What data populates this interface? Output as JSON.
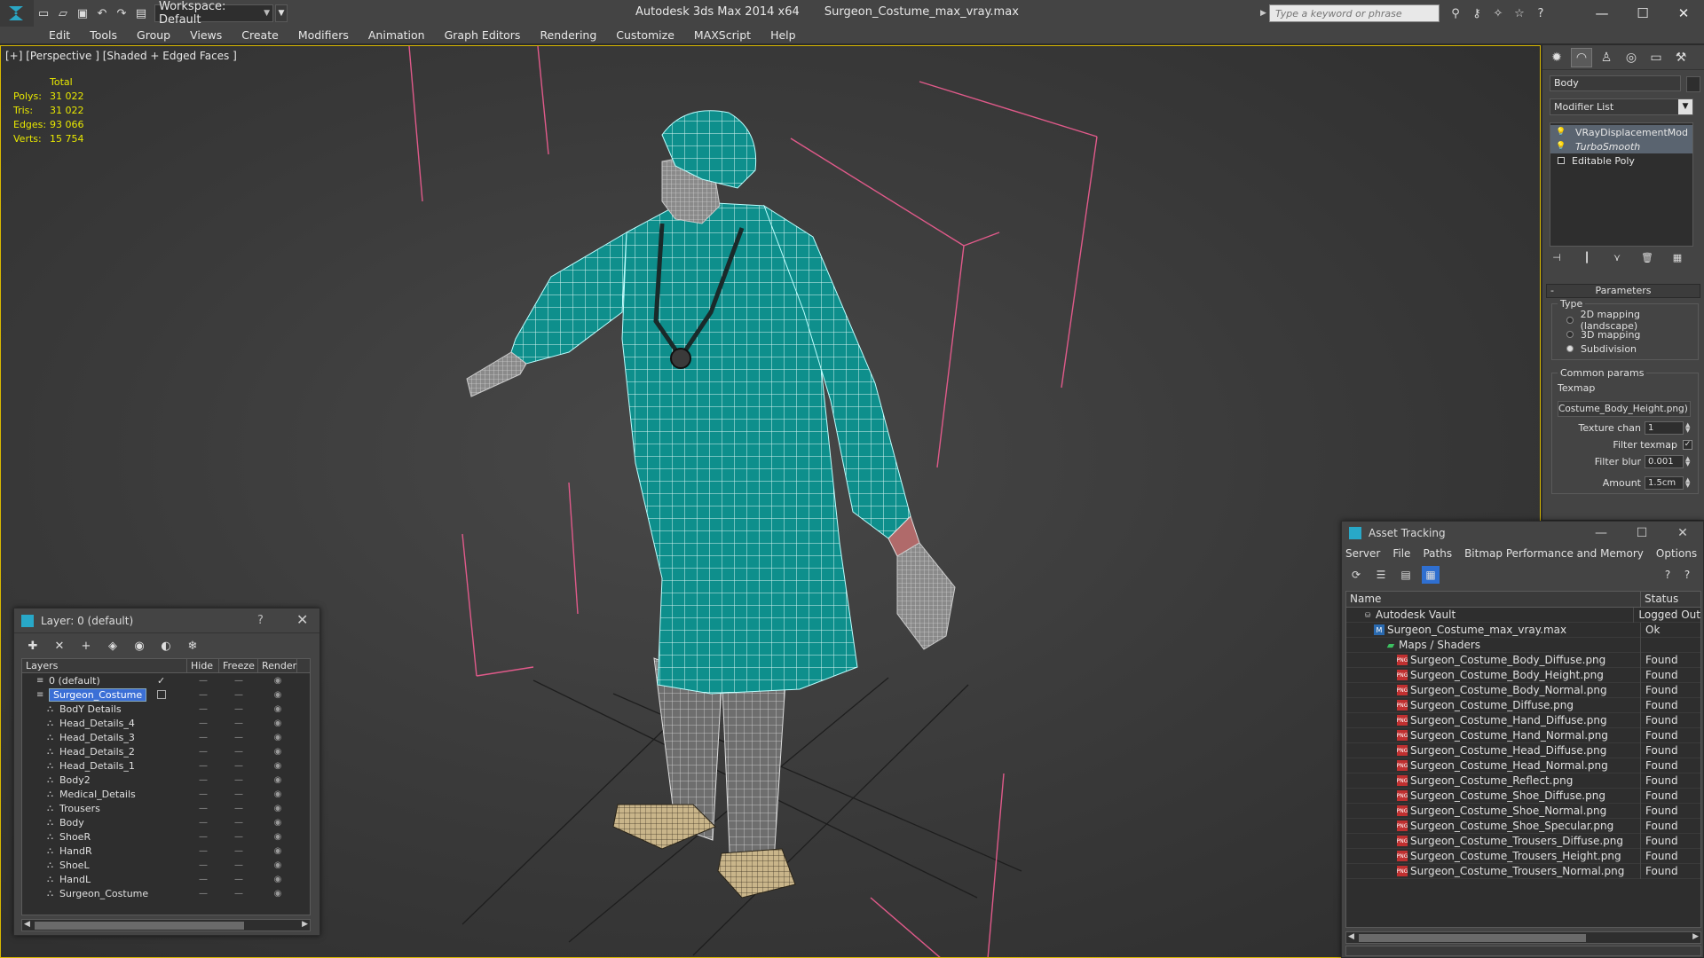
{
  "titlebar": {
    "workspace": "Workspace: Default",
    "app_name": "Autodesk 3ds Max  2014 x64",
    "file_name": "Surgeon_Costume_max_vray.max",
    "search_placeholder": "Type a keyword or phrase"
  },
  "menu": [
    "Edit",
    "Tools",
    "Group",
    "Views",
    "Create",
    "Modifiers",
    "Animation",
    "Graph Editors",
    "Rendering",
    "Customize",
    "MAXScript",
    "Help"
  ],
  "viewport": {
    "label": "[+] [Perspective ] [Shaded + Edged Faces ]",
    "stats": {
      "total_label": "Total",
      "rows": [
        {
          "label": "Polys:",
          "value": "31 022"
        },
        {
          "label": "Tris:",
          "value": "31 022"
        },
        {
          "label": "Edges:",
          "value": "93 066"
        },
        {
          "label": "Verts:",
          "value": "15 754"
        }
      ]
    }
  },
  "command_panel": {
    "object_name": "Body",
    "modifier_list": "Modifier List",
    "stack": [
      {
        "name": "VRayDisplacementMod",
        "italic": false,
        "selected": true
      },
      {
        "name": "TurboSmooth",
        "italic": true,
        "selected": true
      },
      {
        "name": "Editable Poly",
        "italic": false,
        "selected": false
      }
    ],
    "parameters_title": "Parameters",
    "type_group": "Type",
    "type_options": [
      "2D mapping (landscape)",
      "3D mapping",
      "Subdivision"
    ],
    "type_selected": 2,
    "common_group": "Common params",
    "texmap_label": "Texmap",
    "texmap_value": "Costume_Body_Height.png)",
    "texture_chan_label": "Texture chan",
    "texture_chan_value": "1",
    "filter_texmap_label": "Filter texmap",
    "filter_blur_label": "Filter blur",
    "filter_blur_value": "0.001",
    "amount_label": "Amount",
    "amount_value": "1.5cm"
  },
  "layer_window": {
    "title": "Layer: 0 (default)",
    "help": "?",
    "columns": [
      "Layers",
      "Hide",
      "Freeze",
      "Render"
    ],
    "rows": [
      {
        "name": "0 (default)",
        "level": 0,
        "type": "layer",
        "active": true,
        "selected": false
      },
      {
        "name": "Surgeon_Costume",
        "level": 0,
        "type": "layer",
        "active": false,
        "selected": true
      },
      {
        "name": "BodY Details",
        "level": 1,
        "type": "object"
      },
      {
        "name": "Head_Details_4",
        "level": 1,
        "type": "object"
      },
      {
        "name": "Head_Details_3",
        "level": 1,
        "type": "object"
      },
      {
        "name": "Head_Details_2",
        "level": 1,
        "type": "object"
      },
      {
        "name": "Head_Details_1",
        "level": 1,
        "type": "object"
      },
      {
        "name": "Body2",
        "level": 1,
        "type": "object"
      },
      {
        "name": "Medical_Details",
        "level": 1,
        "type": "object"
      },
      {
        "name": "Trousers",
        "level": 1,
        "type": "object"
      },
      {
        "name": "Body",
        "level": 1,
        "type": "object"
      },
      {
        "name": "ShoeR",
        "level": 1,
        "type": "object"
      },
      {
        "name": "HandR",
        "level": 1,
        "type": "object"
      },
      {
        "name": "ShoeL",
        "level": 1,
        "type": "object"
      },
      {
        "name": "HandL",
        "level": 1,
        "type": "object"
      },
      {
        "name": "Surgeon_Costume",
        "level": 1,
        "type": "object"
      }
    ]
  },
  "asset_window": {
    "title": "Asset Tracking",
    "menu": [
      "Server",
      "File",
      "Paths",
      "Bitmap Performance and Memory",
      "Options"
    ],
    "columns": [
      "Name",
      "Status"
    ],
    "rows": [
      {
        "name": "Autodesk Vault",
        "status": "Logged Out",
        "level": 0,
        "icon": "vault"
      },
      {
        "name": "Surgeon_Costume_max_vray.max",
        "status": "Ok",
        "level": 1,
        "icon": "max"
      },
      {
        "name": "Maps / Shaders",
        "status": "",
        "level": 2,
        "icon": "folder"
      },
      {
        "name": "Surgeon_Costume_Body_Diffuse.png",
        "status": "Found",
        "level": 3,
        "icon": "png"
      },
      {
        "name": "Surgeon_Costume_Body_Height.png",
        "status": "Found",
        "level": 3,
        "icon": "png"
      },
      {
        "name": "Surgeon_Costume_Body_Normal.png",
        "status": "Found",
        "level": 3,
        "icon": "png"
      },
      {
        "name": "Surgeon_Costume_Diffuse.png",
        "status": "Found",
        "level": 3,
        "icon": "png"
      },
      {
        "name": "Surgeon_Costume_Hand_Diffuse.png",
        "status": "Found",
        "level": 3,
        "icon": "png"
      },
      {
        "name": "Surgeon_Costume_Hand_Normal.png",
        "status": "Found",
        "level": 3,
        "icon": "png"
      },
      {
        "name": "Surgeon_Costume_Head_Diffuse.png",
        "status": "Found",
        "level": 3,
        "icon": "png"
      },
      {
        "name": "Surgeon_Costume_Head_Normal.png",
        "status": "Found",
        "level": 3,
        "icon": "png"
      },
      {
        "name": "Surgeon_Costume_Reflect.png",
        "status": "Found",
        "level": 3,
        "icon": "png"
      },
      {
        "name": "Surgeon_Costume_Shoe_Diffuse.png",
        "status": "Found",
        "level": 3,
        "icon": "png"
      },
      {
        "name": "Surgeon_Costume_Shoe_Normal.png",
        "status": "Found",
        "level": 3,
        "icon": "png"
      },
      {
        "name": "Surgeon_Costume_Shoe_Specular.png",
        "status": "Found",
        "level": 3,
        "icon": "png"
      },
      {
        "name": "Surgeon_Costume_Trousers_Diffuse.png",
        "status": "Found",
        "level": 3,
        "icon": "png"
      },
      {
        "name": "Surgeon_Costume_Trousers_Height.png",
        "status": "Found",
        "level": 3,
        "icon": "png"
      },
      {
        "name": "Surgeon_Costume_Trousers_Normal.png",
        "status": "Found",
        "level": 3,
        "icon": "png"
      }
    ]
  },
  "colors": {
    "viewport_border": "#d8b800",
    "stats_text": "#e8e800",
    "costume_teal": "#0e8f8c",
    "bbox_pink": "#e05a8a",
    "selection_blue": "#3b6fd6"
  }
}
